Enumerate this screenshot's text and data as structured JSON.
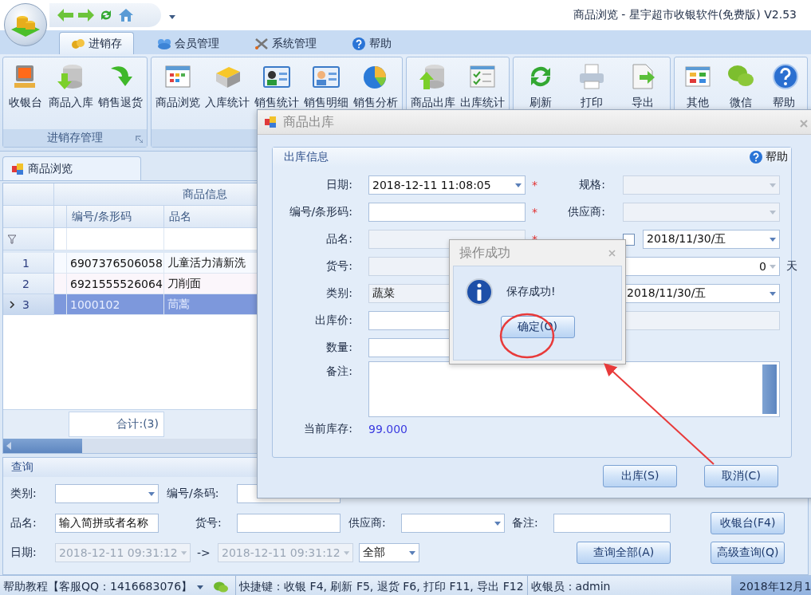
{
  "window": {
    "title": "商品浏览 - 星宇超市收银软件(免费版) V2.53"
  },
  "ribbon_tabs": [
    {
      "label": "进销存",
      "selected": true
    },
    {
      "label": "会员管理",
      "selected": false
    },
    {
      "label": "系统管理",
      "selected": false
    },
    {
      "label": "帮助",
      "selected": false
    }
  ],
  "ribbon_groups": [
    {
      "label": "进销存管理",
      "buttons": [
        "收银台",
        "商品入库",
        "销售退货"
      ]
    },
    {
      "buttons": [
        "商品浏览",
        "入库统计",
        "销售统计",
        "销售明细",
        "销售分析"
      ]
    },
    {
      "buttons": [
        "商品出库",
        "出库统计"
      ]
    },
    {
      "buttons": [
        "刷新",
        "打印",
        "导出"
      ]
    },
    {
      "buttons": [
        "其他",
        "微信",
        "帮助"
      ]
    }
  ],
  "document_tabs": [
    {
      "label": "商品浏览",
      "selected": true
    }
  ],
  "grid": {
    "band": "商品信息",
    "columns": [
      "编号/条形码",
      "品名"
    ],
    "rows": [
      {
        "number": "1",
        "code": "6907376506058",
        "name": "儿童活力清新洗",
        "selected": false
      },
      {
        "number": "2",
        "code": "6921555526064",
        "name": "刀削面",
        "selected": false
      },
      {
        "number": "3",
        "code": "1000102",
        "name": "茼蒿",
        "selected": true
      }
    ],
    "footer": "合计:(3)"
  },
  "query": {
    "title": "查询",
    "rows": [
      [
        {
          "kind": "label",
          "text": "类别:"
        },
        {
          "kind": "select"
        },
        {
          "kind": "label",
          "text": "编号/条码:"
        },
        {
          "kind": "input"
        }
      ],
      [
        {
          "kind": "label",
          "text": "品名:"
        },
        {
          "kind": "input",
          "value": "输入简拼或者名称"
        },
        {
          "kind": "label",
          "text": "货号:"
        },
        {
          "kind": "input"
        },
        {
          "kind": "label",
          "text": "供应商:"
        },
        {
          "kind": "select"
        },
        {
          "kind": "label",
          "text": "备注:"
        },
        {
          "kind": "input"
        }
      ],
      [
        {
          "kind": "label",
          "text": "日期:"
        },
        {
          "kind": "date",
          "value": "2018-12-11 09:31:12",
          "disabled": true
        },
        {
          "kind": "label",
          "text": "->"
        },
        {
          "kind": "date",
          "value": "2018-12-11 09:31:12",
          "disabled": true
        },
        {
          "kind": "select",
          "value": "全部"
        }
      ]
    ],
    "buttons": [
      "收银台(F4)",
      "查询全部(A)",
      "高级查询(Q)"
    ]
  },
  "status_bar": {
    "help": "帮助教程【客服QQ：1416683076】",
    "shortcuts": "快捷键：收银 F4, 刷新 F5, 退货 F6, 打印 F11, 导出 F12",
    "cashier": "收银员：admin",
    "date": "2018年12月1"
  },
  "dialog": {
    "title": "商品出库",
    "group_title": "出库信息",
    "help_link": "帮助",
    "left_fields": [
      {
        "label": "日期:",
        "kind": "select",
        "value": "2018-12-11 11:08:05",
        "disabled": false,
        "required": true
      },
      {
        "label": "编号/条形码:",
        "kind": "input",
        "disabled": false,
        "required": true
      },
      {
        "label": "品名:",
        "kind": "input",
        "disabled": true,
        "required": true
      },
      {
        "label": "货号:",
        "kind": "input",
        "disabled": true,
        "required": false
      },
      {
        "label": "类别:",
        "kind": "input",
        "value": "蔬菜",
        "disabled": true,
        "required": false
      },
      {
        "label": "出库价:",
        "kind": "input",
        "disabled": false,
        "required": false
      },
      {
        "label": "数量:",
        "kind": "input",
        "disabled": false,
        "required": false
      }
    ],
    "right_fields": [
      {
        "label": "规格:",
        "kind": "select",
        "disabled": true
      },
      {
        "label": "供应商:",
        "kind": "select",
        "disabled": true
      },
      {
        "kind": "checkdate",
        "value": "2018/11/30/五",
        "checked": false,
        "disabled": false
      },
      {
        "kind": "number",
        "value": "0",
        "unit": "天",
        "disabled": false
      },
      {
        "kind": "select",
        "value": "2018/11/30/五",
        "disabled": false
      },
      {
        "kind": "input",
        "disabled": true
      }
    ],
    "required_mark": "*",
    "remark_label": "备注:",
    "stock_label": "当前库存:",
    "stock_value": "99.000",
    "buttons": [
      "出库(S)",
      "取消(C)"
    ]
  },
  "message_box": {
    "title": "操作成功",
    "text": "保存成功!",
    "button": "确定(O)"
  }
}
